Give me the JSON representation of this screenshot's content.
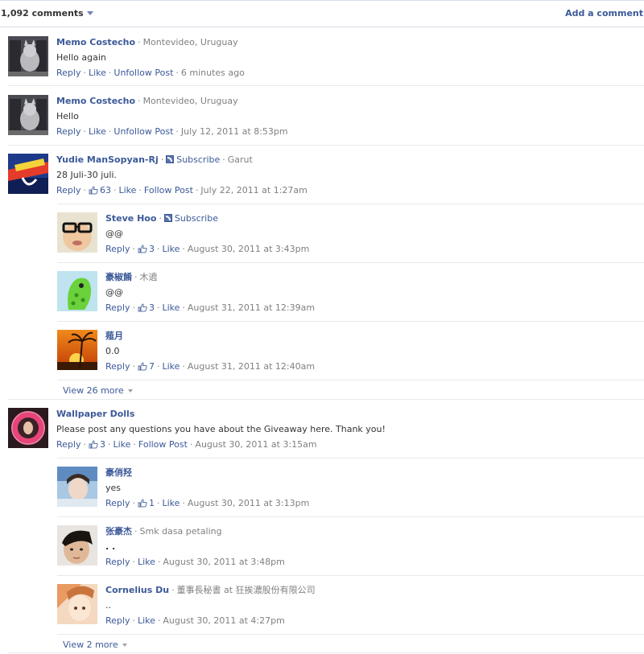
{
  "header": {
    "count_label": "1,092 comments",
    "add_label": "Add a comment"
  },
  "comments": [
    {
      "author": "Memo Costecho",
      "meta_label": "Montevideo, Uruguay",
      "text": "Hello again",
      "reply": "Reply",
      "like": "Like",
      "follow": "Unfollow Post",
      "time": "6 minutes ago"
    },
    {
      "author": "Memo Costecho",
      "meta_label": "Montevideo, Uruguay",
      "text": "Hello",
      "reply": "Reply",
      "like": "Like",
      "follow": "Unfollow Post",
      "time": "July 12, 2011 at 8:53pm"
    },
    {
      "author": "Yudie ManSopyan-Rj",
      "subscribe": "Subscribe",
      "meta_label": "Garut",
      "text": "28 Juli-30 juli.",
      "reply": "Reply",
      "likes": "63",
      "like": "Like",
      "follow": "Follow Post",
      "time": "July 22, 2011 at 1:27am"
    },
    {
      "author": "Wallpaper Dolls",
      "text": "Please post any questions you have about the Giveaway here. Thank you!",
      "reply": "Reply",
      "likes": "3",
      "like": "Like",
      "follow": "Follow Post",
      "time": "August 30, 2011 at 3:15am"
    }
  ],
  "replies": [
    {
      "author": "Steve Hoo",
      "subscribe": "Subscribe",
      "text": "@@",
      "reply": "Reply",
      "likes": "3",
      "like": "Like",
      "time": "August 30, 2011 at 3:43pm"
    },
    {
      "author": "豪椒餚",
      "meta_label": "木遶",
      "text": "@@",
      "reply": "Reply",
      "likes": "3",
      "like": "Like",
      "time": "August 31, 2011 at 12:39am"
    },
    {
      "author": "薤月",
      "text": "0.0",
      "reply": "Reply",
      "likes": "7",
      "like": "Like",
      "time": "August 31, 2011 at 12:40am"
    },
    {
      "author": "豪俏羟",
      "text": "yes",
      "reply": "Reply",
      "likes": "1",
      "like": "Like",
      "time": "August 30, 2011 at 3:13pm"
    },
    {
      "author": "张豪杰",
      "meta_label": "Smk dasa petaling",
      "text": ". .",
      "reply": "Reply",
      "like": "Like",
      "time": "August 30, 2011 at 3:48pm"
    },
    {
      "author": "Cornelius Du",
      "meta_label": "董事長秘書 at 狂挨濃股份有限公司",
      "text": "..",
      "reply": "Reply",
      "like": "Like",
      "time": "August 30, 2011 at 4:27pm"
    }
  ],
  "view_more": {
    "first": "View 26 more",
    "second": "View 2 more"
  },
  "icons": {
    "dropdown": "chevron-down-icon",
    "subscribe": "rss-icon",
    "like": "thumbs-up-icon"
  },
  "colors": {
    "link": "#3b5998",
    "meta": "#808080",
    "border": "#e9e9e9"
  }
}
